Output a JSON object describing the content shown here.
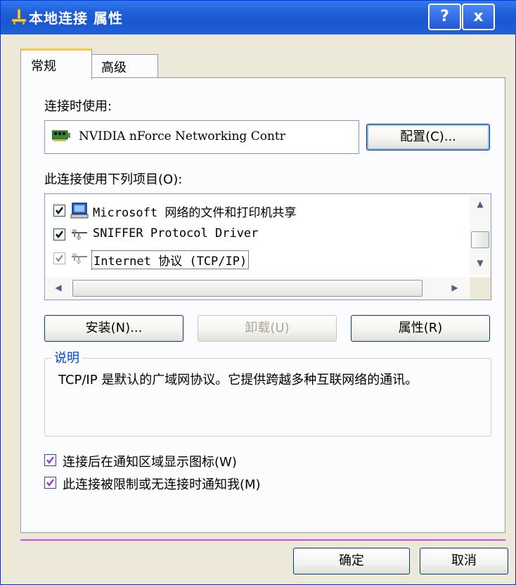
{
  "window": {
    "title": "本地连接 属性",
    "help_label": "?",
    "close_label": "x"
  },
  "tabs": [
    {
      "label": "常规",
      "selected": true
    },
    {
      "label": "高级",
      "selected": false
    }
  ],
  "connect_using": {
    "label": "连接时使用:",
    "adapter": "NVIDIA nForce Networking Contr",
    "configure_label": "配置(C)..."
  },
  "components": {
    "label": "此连接使用下列项目(O):",
    "items": [
      {
        "label": "Microsoft 网络的文件和打印机共享",
        "icon": "computer-share-icon",
        "checked": true
      },
      {
        "label": "SNIFFER Protocol Driver",
        "icon": "network-protocol-icon",
        "checked": true
      },
      {
        "label": "Internet 协议 (TCP/IP)",
        "icon": "network-protocol-icon",
        "checked": true,
        "selected": true
      }
    ]
  },
  "buttons": {
    "install": "安装(N)...",
    "uninstall": "卸载(U)",
    "properties": "属性(R)",
    "ok": "确定",
    "cancel": "取消"
  },
  "description": {
    "title": "说明",
    "text": "TCP/IP 是默认的广域网协议。它提供跨越多种互联网络的通讯。"
  },
  "options": [
    {
      "label": "连接后在通知区域显示图标(W)",
      "checked": true
    },
    {
      "label": "此连接被限制或无连接时通知我(M)",
      "checked": true
    }
  ],
  "colors": {
    "titlebar": "#2061d8",
    "accent_tab": "#ffc83c",
    "group_title": "#0046d5"
  }
}
